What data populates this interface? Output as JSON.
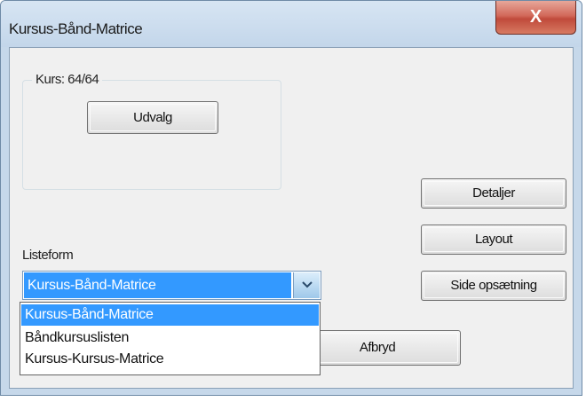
{
  "window": {
    "title": "Kursus-Bånd-Matrice",
    "close_symbol": "X"
  },
  "group": {
    "legend": "Kurs: 64/64",
    "select_button": "Udvalg"
  },
  "buttons": {
    "details": "Detaljer",
    "layout": "Layout",
    "page_setup": "Side opsætning",
    "cancel": "Afbryd"
  },
  "list_form": {
    "label": "Listeform",
    "selected": "Kursus-Bånd-Matrice",
    "options": [
      "Kursus-Bånd-Matrice",
      "Båndkursuslisten",
      "Kursus-Kursus-Matrice"
    ]
  },
  "colors": {
    "selection": "#3399ff",
    "close_button": "#c94b3c",
    "dialog_face": "#f0f0f0"
  },
  "icons": {
    "close": "close-icon",
    "dropdown": "chevron-down-icon"
  }
}
